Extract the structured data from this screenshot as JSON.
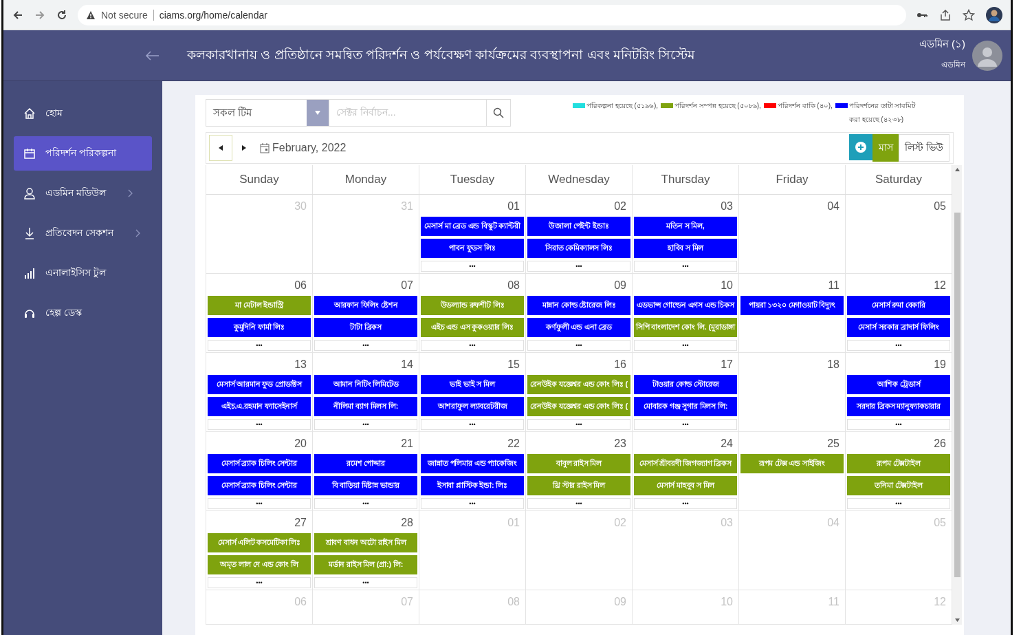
{
  "browser": {
    "security": "Not secure",
    "url": "ciams.org/home/calendar"
  },
  "header": {
    "title": "কলকারখানায় ও প্রতিষ্ঠানে সমন্বিত পরিদর্শন ও পর্যবেক্ষণ কার্যক্রমের ব্যবস্থাপনা এবং মনিটরিং সিস্টেম",
    "user_name": "এডমিন (১)",
    "user_role": "এডমিন"
  },
  "sidebar": {
    "items": [
      {
        "label": "হোম",
        "kind": "home",
        "selected": false,
        "has_submenu": false
      },
      {
        "label": "পরিদর্শন পরিকল্পনা",
        "kind": "calendar",
        "selected": true,
        "has_submenu": false
      },
      {
        "label": "এডমিন মডিউল",
        "kind": "user",
        "selected": false,
        "has_submenu": true
      },
      {
        "label": "প্রতিবেদন সেকশন",
        "kind": "download",
        "selected": false,
        "has_submenu": true
      },
      {
        "label": "এনালাইসিস টুল",
        "kind": "chart",
        "selected": false,
        "has_submenu": false
      },
      {
        "label": "হেল্প ডেস্ক",
        "kind": "headset",
        "selected": false,
        "has_submenu": false
      }
    ]
  },
  "filters": {
    "team": "সকল টিম",
    "sector_placeholder": "সেক্টর নির্বাচন..."
  },
  "legend": [
    {
      "label": "পরিকল্পনা হয়েছে (৫১৯৬),",
      "color": "#22dede"
    },
    {
      "label": "পরিদর্শন সম্পন্ন হয়েছে (৫০৮৯),",
      "color": "#7fa30e"
    },
    {
      "label": "পরিদর্শন বাকি (৪০),",
      "color": "#ff0000"
    },
    {
      "label": "পরিদর্শনের ডাটা সাবমিট করা হয়েছে (৪২৩৮)",
      "color": "#0000ff"
    }
  ],
  "calendar": {
    "month": "February, 2022",
    "views": [
      {
        "label": "মাস",
        "selected": true
      },
      {
        "label": "লিস্ট ভিউ",
        "selected": false
      }
    ],
    "weekdays": [
      "Sunday",
      "Monday",
      "Tuesday",
      "Wednesday",
      "Thursday",
      "Friday",
      "Saturday"
    ],
    "weeks": [
      {
        "days": [
          {
            "day": "30",
            "other_month": true
          },
          {
            "day": "31",
            "other_month": true
          },
          {
            "day": "01",
            "other_month": false,
            "events": [
              {
                "title": "মেসার্স মা ব্রেড এন্ড বিস্কুট ক্যান্টরী",
                "color": "#0000ff"
              },
              {
                "title": "পাবন ফুডস লিঃ",
                "color": "#0000ff"
              }
            ],
            "more": "•••"
          },
          {
            "day": "02",
            "other_month": false,
            "events": [
              {
                "title": "উজালা পেইন্ট ইন্ডাঃ",
                "color": "#0000ff"
              },
              {
                "title": "সিরাত কেমিক্যালস লিঃ",
                "color": "#0000ff"
              }
            ],
            "more": "•••"
          },
          {
            "day": "03",
            "other_month": false,
            "events": [
              {
                "title": "মতিন স মিল,",
                "color": "#0000ff"
              },
              {
                "title": "হাবিব স মিল",
                "color": "#0000ff"
              }
            ],
            "more": "•••"
          },
          {
            "day": "04",
            "other_month": false
          },
          {
            "day": "05",
            "other_month": false
          }
        ]
      },
      {
        "days": [
          {
            "day": "06",
            "other_month": false,
            "events": [
              {
                "title": "মা মেটাল ইন্ডাস্ট্রি",
                "color": "#7fa30e"
              },
              {
                "title": "কুমুদিনি ফার্মা লিঃ",
                "color": "#0000ff"
              }
            ],
            "more": "•••"
          },
          {
            "day": "07",
            "other_month": false,
            "events": [
              {
                "title": "আরফান ফিলিং ষ্টেশন",
                "color": "#0000ff"
              },
              {
                "title": "টাটা ব্রিকস",
                "color": "#0000ff"
              }
            ],
            "more": "•••"
          },
          {
            "day": "08",
            "other_month": false,
            "events": [
              {
                "title": "উডল্যান্ড রুফশীট লিঃ",
                "color": "#7fa30e"
              },
              {
                "title": "এইচ এন্ড এস কুকওয়্যার লিঃ",
                "color": "#7fa30e"
              }
            ],
            "more": "•••"
          },
          {
            "day": "09",
            "other_month": false,
            "events": [
              {
                "title": "মান্নান কোল্ড ষ্টোরেজ লিঃ",
                "color": "#0000ff"
              },
              {
                "title": "কর্ণফুলী এন্ড এনা ব্রেড",
                "color": "#0000ff"
              }
            ],
            "more": "•••"
          },
          {
            "day": "10",
            "other_month": false,
            "events": [
              {
                "title": "এডভান্স গোল্ডেন এগস এন্ড চিকস",
                "color": "#0000ff"
              },
              {
                "title": "সিপি বাংলাদেশ কোং লি. (মুরাডাঙ্গা",
                "color": "#7fa30e"
              }
            ],
            "more": "•••"
          },
          {
            "day": "11",
            "other_month": false,
            "events": [
              {
                "title": "পায়রা ১৩২০ মেগাওয়াট বিদ্যুৎ",
                "color": "#0000ff"
              }
            ]
          },
          {
            "day": "12",
            "other_month": false,
            "events": [
              {
                "title": "মেসার্স রুমা বেকারি",
                "color": "#0000ff"
              },
              {
                "title": "মেসার্স সরকার ব্রাদার্স ফিলিং",
                "color": "#0000ff"
              }
            ],
            "more": "•••"
          }
        ]
      },
      {
        "days": [
          {
            "day": "13",
            "other_month": false,
            "events": [
              {
                "title": "মেসার্স আরমান ফুড প্রোডাক্টস",
                "color": "#0000ff"
              },
              {
                "title": "এইচ.এ.রহমান ফ্যাসেইনার্স",
                "color": "#0000ff"
              }
            ],
            "more": "•••"
          },
          {
            "day": "14",
            "other_month": false,
            "events": [
              {
                "title": "আমান নিটিং লিমিটেড",
                "color": "#0000ff"
              },
              {
                "title": "নীলিমা ব্যাগ মিলস লি:",
                "color": "#0000ff"
              }
            ],
            "more": "•••"
          },
          {
            "day": "15",
            "other_month": false,
            "events": [
              {
                "title": "ভাই ভাই স মিল",
                "color": "#0000ff"
              },
              {
                "title": "আশরাফুল ল্যাবরেটরীজ",
                "color": "#0000ff"
              }
            ],
            "more": "•••"
          },
          {
            "day": "16",
            "other_month": false,
            "events": [
              {
                "title": "রেনউইক যজ্ঞেশ্বর এন্ড কোং লিঃ (",
                "color": "#7fa30e"
              },
              {
                "title": "রেনউইক যজ্ঞেশ্বর এন্ড কোং লিঃ (",
                "color": "#7fa30e"
              }
            ],
            "more": "•••"
          },
          {
            "day": "17",
            "other_month": false,
            "events": [
              {
                "title": "টাওয়ার কোল্ড স্টোরেজ",
                "color": "#0000ff"
              },
              {
                "title": "মোবারক গঞ্জ সুগার মিলস লি:",
                "color": "#0000ff"
              }
            ],
            "more": "•••"
          },
          {
            "day": "18",
            "other_month": false
          },
          {
            "day": "19",
            "other_month": false,
            "events": [
              {
                "title": "আশিক ট্রেডার্স",
                "color": "#0000ff"
              },
              {
                "title": "সরদার ব্রিকস ম্যানুফ্যাকচারার",
                "color": "#0000ff"
              }
            ],
            "more": "•••"
          }
        ]
      },
      {
        "days": [
          {
            "day": "20",
            "other_month": false,
            "events": [
              {
                "title": "মেসার্স ব্র্যাক চিলিং সেন্টার",
                "color": "#0000ff"
              },
              {
                "title": "মেসার্স ব্র্যাক চিলিং সেন্টার",
                "color": "#0000ff"
              }
            ],
            "more": "•••"
          },
          {
            "day": "21",
            "other_month": false,
            "events": [
              {
                "title": "রমেশ পোদ্দার",
                "color": "#0000ff"
              },
              {
                "title": "বি বাড়িয়া মিষ্টান্ন ভান্ডার",
                "color": "#0000ff"
              }
            ],
            "more": "•••"
          },
          {
            "day": "22",
            "other_month": false,
            "events": [
              {
                "title": "জান্নাত পলিমার এন্ড প্যাকেজিং",
                "color": "#0000ff"
              },
              {
                "title": "ইসাবা প্লাস্টিক ইন্ডা: লিঃ",
                "color": "#0000ff"
              }
            ],
            "more": "•••"
          },
          {
            "day": "23",
            "other_month": false,
            "events": [
              {
                "title": "বাবুল রাইস মিল",
                "color": "#7fa30e"
              },
              {
                "title": "থ্রি স্টার রাইস মিল",
                "color": "#7fa30e"
              }
            ],
            "more": "•••"
          },
          {
            "day": "24",
            "other_month": false,
            "events": [
              {
                "title": "মেসার্স শ্রীবরদী জিগজ্যাগ ব্রিকস",
                "color": "#7fa30e"
              },
              {
                "title": "মেসার্স মাহবুব স মিল",
                "color": "#7fa30e"
              }
            ],
            "more": "•••"
          },
          {
            "day": "25",
            "other_month": false,
            "events": [
              {
                "title": "রূপম টেক্স এন্ড সাইজিং",
                "color": "#7fa30e"
              }
            ]
          },
          {
            "day": "26",
            "other_month": false,
            "events": [
              {
                "title": "রূপম টেক্সটাইল",
                "color": "#7fa30e"
              },
              {
                "title": "তনিমা টেক্সটাইল",
                "color": "#7fa30e"
              }
            ],
            "more": "•••"
          }
        ]
      },
      {
        "days": [
          {
            "day": "27",
            "other_month": false,
            "events": [
              {
                "title": "মেসার্স এলিট কসমেটিকা লিঃ",
                "color": "#7fa30e"
              },
              {
                "title": "অমৃত লাল দে এন্ড কোং লি",
                "color": "#7fa30e"
              }
            ],
            "more": "•••"
          },
          {
            "day": "28",
            "other_month": false,
            "events": [
              {
                "title": "শ্রাবণ বাধন অটো রাইস মিল",
                "color": "#7fa30e"
              },
              {
                "title": "মর্ডান রাইস মিল (প্রা:) লি:",
                "color": "#7fa30e"
              }
            ],
            "more": "•••"
          },
          {
            "day": "01",
            "other_month": true
          },
          {
            "day": "02",
            "other_month": true
          },
          {
            "day": "03",
            "other_month": true
          },
          {
            "day": "04",
            "other_month": true
          },
          {
            "day": "05",
            "other_month": true
          }
        ]
      },
      {
        "days": [
          {
            "day": "06",
            "other_month": true
          },
          {
            "day": "07",
            "other_month": true
          },
          {
            "day": "08",
            "other_month": true
          },
          {
            "day": "09",
            "other_month": true
          },
          {
            "day": "10",
            "other_month": true
          },
          {
            "day": "11",
            "other_month": true
          },
          {
            "day": "12",
            "other_month": true
          }
        ]
      }
    ]
  }
}
